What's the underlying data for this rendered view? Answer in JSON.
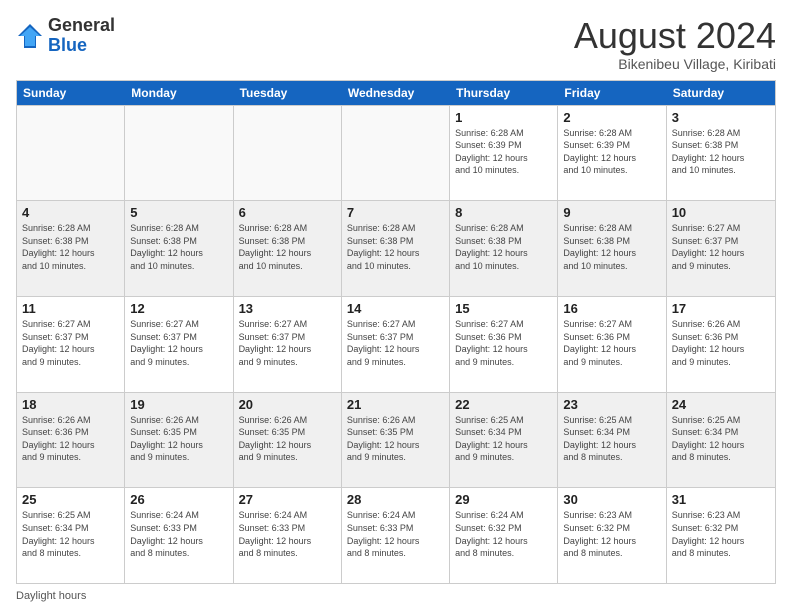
{
  "logo": {
    "general": "General",
    "blue": "Blue"
  },
  "title": "August 2024",
  "subtitle": "Bikenibeu Village, Kiribati",
  "days_of_week": [
    "Sunday",
    "Monday",
    "Tuesday",
    "Wednesday",
    "Thursday",
    "Friday",
    "Saturday"
  ],
  "footer_text": "Daylight hours",
  "weeks": [
    [
      {
        "day": "",
        "info": ""
      },
      {
        "day": "",
        "info": ""
      },
      {
        "day": "",
        "info": ""
      },
      {
        "day": "",
        "info": ""
      },
      {
        "day": "1",
        "info": "Sunrise: 6:28 AM\nSunset: 6:39 PM\nDaylight: 12 hours\nand 10 minutes."
      },
      {
        "day": "2",
        "info": "Sunrise: 6:28 AM\nSunset: 6:39 PM\nDaylight: 12 hours\nand 10 minutes."
      },
      {
        "day": "3",
        "info": "Sunrise: 6:28 AM\nSunset: 6:38 PM\nDaylight: 12 hours\nand 10 minutes."
      }
    ],
    [
      {
        "day": "4",
        "info": "Sunrise: 6:28 AM\nSunset: 6:38 PM\nDaylight: 12 hours\nand 10 minutes."
      },
      {
        "day": "5",
        "info": "Sunrise: 6:28 AM\nSunset: 6:38 PM\nDaylight: 12 hours\nand 10 minutes."
      },
      {
        "day": "6",
        "info": "Sunrise: 6:28 AM\nSunset: 6:38 PM\nDaylight: 12 hours\nand 10 minutes."
      },
      {
        "day": "7",
        "info": "Sunrise: 6:28 AM\nSunset: 6:38 PM\nDaylight: 12 hours\nand 10 minutes."
      },
      {
        "day": "8",
        "info": "Sunrise: 6:28 AM\nSunset: 6:38 PM\nDaylight: 12 hours\nand 10 minutes."
      },
      {
        "day": "9",
        "info": "Sunrise: 6:28 AM\nSunset: 6:38 PM\nDaylight: 12 hours\nand 10 minutes."
      },
      {
        "day": "10",
        "info": "Sunrise: 6:27 AM\nSunset: 6:37 PM\nDaylight: 12 hours\nand 9 minutes."
      }
    ],
    [
      {
        "day": "11",
        "info": "Sunrise: 6:27 AM\nSunset: 6:37 PM\nDaylight: 12 hours\nand 9 minutes."
      },
      {
        "day": "12",
        "info": "Sunrise: 6:27 AM\nSunset: 6:37 PM\nDaylight: 12 hours\nand 9 minutes."
      },
      {
        "day": "13",
        "info": "Sunrise: 6:27 AM\nSunset: 6:37 PM\nDaylight: 12 hours\nand 9 minutes."
      },
      {
        "day": "14",
        "info": "Sunrise: 6:27 AM\nSunset: 6:37 PM\nDaylight: 12 hours\nand 9 minutes."
      },
      {
        "day": "15",
        "info": "Sunrise: 6:27 AM\nSunset: 6:36 PM\nDaylight: 12 hours\nand 9 minutes."
      },
      {
        "day": "16",
        "info": "Sunrise: 6:27 AM\nSunset: 6:36 PM\nDaylight: 12 hours\nand 9 minutes."
      },
      {
        "day": "17",
        "info": "Sunrise: 6:26 AM\nSunset: 6:36 PM\nDaylight: 12 hours\nand 9 minutes."
      }
    ],
    [
      {
        "day": "18",
        "info": "Sunrise: 6:26 AM\nSunset: 6:36 PM\nDaylight: 12 hours\nand 9 minutes."
      },
      {
        "day": "19",
        "info": "Sunrise: 6:26 AM\nSunset: 6:35 PM\nDaylight: 12 hours\nand 9 minutes."
      },
      {
        "day": "20",
        "info": "Sunrise: 6:26 AM\nSunset: 6:35 PM\nDaylight: 12 hours\nand 9 minutes."
      },
      {
        "day": "21",
        "info": "Sunrise: 6:26 AM\nSunset: 6:35 PM\nDaylight: 12 hours\nand 9 minutes."
      },
      {
        "day": "22",
        "info": "Sunrise: 6:25 AM\nSunset: 6:34 PM\nDaylight: 12 hours\nand 9 minutes."
      },
      {
        "day": "23",
        "info": "Sunrise: 6:25 AM\nSunset: 6:34 PM\nDaylight: 12 hours\nand 8 minutes."
      },
      {
        "day": "24",
        "info": "Sunrise: 6:25 AM\nSunset: 6:34 PM\nDaylight: 12 hours\nand 8 minutes."
      }
    ],
    [
      {
        "day": "25",
        "info": "Sunrise: 6:25 AM\nSunset: 6:34 PM\nDaylight: 12 hours\nand 8 minutes."
      },
      {
        "day": "26",
        "info": "Sunrise: 6:24 AM\nSunset: 6:33 PM\nDaylight: 12 hours\nand 8 minutes."
      },
      {
        "day": "27",
        "info": "Sunrise: 6:24 AM\nSunset: 6:33 PM\nDaylight: 12 hours\nand 8 minutes."
      },
      {
        "day": "28",
        "info": "Sunrise: 6:24 AM\nSunset: 6:33 PM\nDaylight: 12 hours\nand 8 minutes."
      },
      {
        "day": "29",
        "info": "Sunrise: 6:24 AM\nSunset: 6:32 PM\nDaylight: 12 hours\nand 8 minutes."
      },
      {
        "day": "30",
        "info": "Sunrise: 6:23 AM\nSunset: 6:32 PM\nDaylight: 12 hours\nand 8 minutes."
      },
      {
        "day": "31",
        "info": "Sunrise: 6:23 AM\nSunset: 6:32 PM\nDaylight: 12 hours\nand 8 minutes."
      }
    ]
  ]
}
